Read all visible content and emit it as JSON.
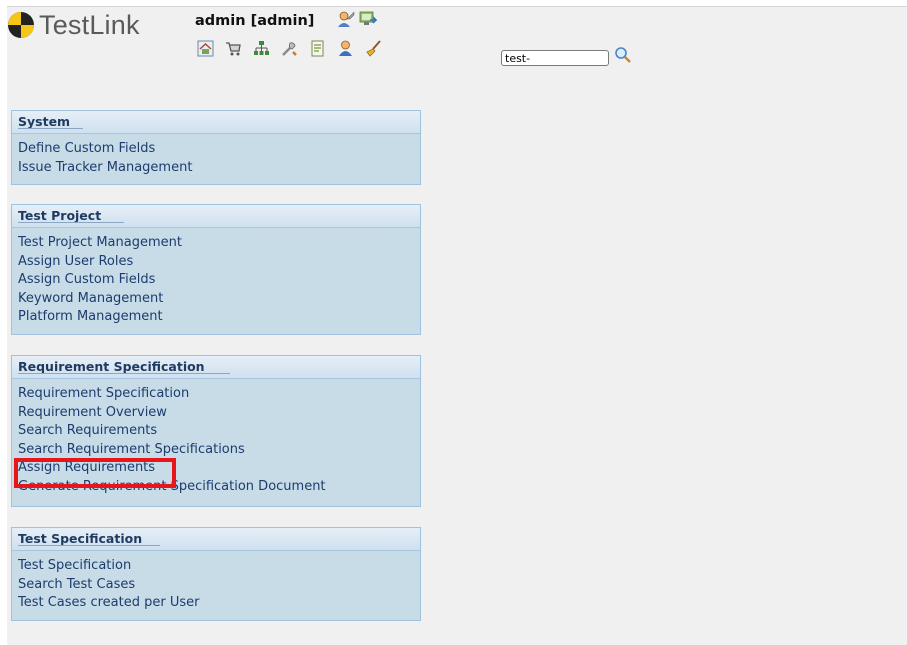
{
  "app": {
    "name": "TestLink",
    "user_label": "admin [admin]"
  },
  "header_icons": [
    "user-settings-icon",
    "logout-icon"
  ],
  "toolbar": {
    "icons": [
      "home-icon",
      "shopping-cart-icon",
      "tree-structure-icon",
      "tools-icon",
      "document-icon",
      "user-icon",
      "broom-icon"
    ]
  },
  "search": {
    "value": "test-",
    "button_icon": "magnifier-icon"
  },
  "menus": {
    "system": {
      "title": "System",
      "items": [
        "Define Custom Fields",
        "Issue Tracker Management"
      ]
    },
    "test_project": {
      "title": "Test Project",
      "items": [
        "Test Project Management",
        "Assign User Roles",
        "Assign Custom Fields",
        "Keyword Management",
        "Platform Management"
      ]
    },
    "requirement_spec": {
      "title": "Requirement Specification",
      "items": [
        "Requirement Specification",
        "Requirement Overview",
        "Search Requirements",
        "Search Requirement Specifications",
        "Assign Requirements",
        "Generate Requirement Specification Document"
      ]
    },
    "test_spec": {
      "title": "Test Specification",
      "items": [
        "Test Specification",
        "Search Test Cases",
        "Test Cases created per User"
      ]
    }
  },
  "colors": {
    "highlight": "#e8151b",
    "menu_background": "#c8dce8",
    "link": "#1c3c6e"
  }
}
